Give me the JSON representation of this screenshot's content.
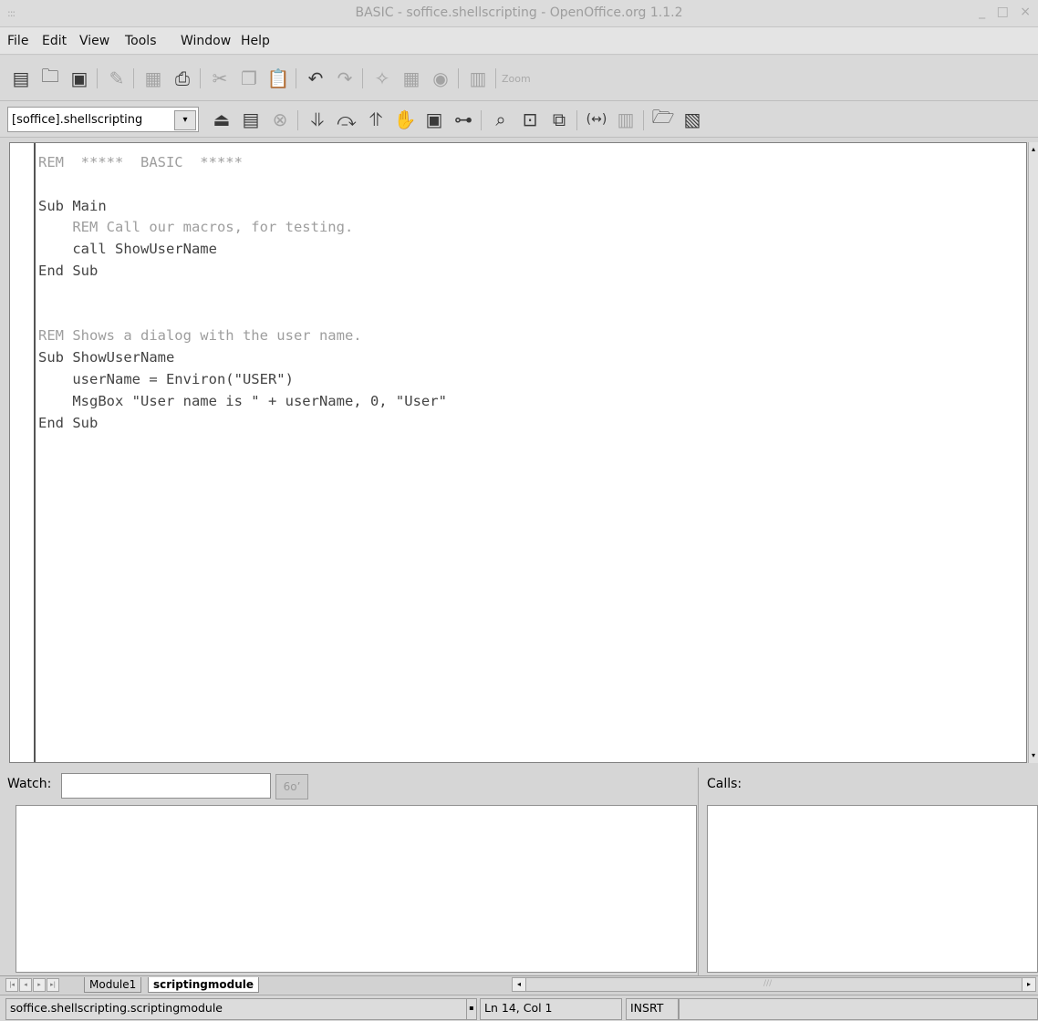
{
  "window": {
    "title": "BASIC - soffice.shellscripting - OpenOffice.org 1.1.2"
  },
  "menu": {
    "items": [
      "File",
      "Edit",
      "View",
      "Tools",
      "Window",
      "Help"
    ]
  },
  "toolbar1": {
    "zoom_label": "Zoom"
  },
  "toolbar2": {
    "library_value": "[soffice].shellscripting"
  },
  "editor": {
    "lines": [
      {
        "text": "REM  *****  BASIC  *****",
        "type": "comment"
      },
      {
        "text": "",
        "type": "code"
      },
      {
        "text": "Sub Main",
        "type": "code"
      },
      {
        "text": "    REM Call our macros, for testing.",
        "type": "comment"
      },
      {
        "text": "    call ShowUserName",
        "type": "code"
      },
      {
        "text": "End Sub",
        "type": "code"
      },
      {
        "text": "",
        "type": "code"
      },
      {
        "text": "",
        "type": "code"
      },
      {
        "text": "REM Shows a dialog with the user name.",
        "type": "comment"
      },
      {
        "text": "Sub ShowUserName",
        "type": "code"
      },
      {
        "text": "    userName = Environ(\"USER\")",
        "type": "code"
      },
      {
        "text": "    MsgBox \"User name is \" + userName, 0, \"User\"",
        "type": "code"
      },
      {
        "text": "End Sub",
        "type": "code"
      }
    ]
  },
  "watch": {
    "label": "Watch:",
    "input_value": "",
    "button_icon": "glasses-icon",
    "button_text": "6o’"
  },
  "calls": {
    "label": "Calls:"
  },
  "tabs": {
    "items": [
      "Module1",
      "scriptingmodule"
    ],
    "active": "scriptingmodule"
  },
  "status": {
    "path": "soffice.shellscripting.scriptingmodule",
    "position": "Ln 14, Col 1",
    "mode": "INSRT"
  }
}
